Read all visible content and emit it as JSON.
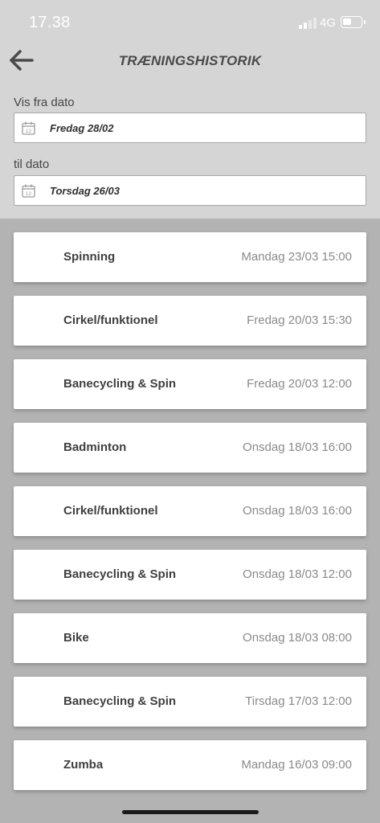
{
  "status_bar": {
    "time": "17.38",
    "network": "4G"
  },
  "header": {
    "title": "TRÆNINGSHISTORIK",
    "back_icon": "arrow-left-icon"
  },
  "filters": {
    "from_label": "Vis fra dato",
    "from_value": "Fredag 28/02",
    "to_label": "til dato",
    "to_value": "Torsdag 26/03",
    "calendar_icon": "calendar-icon",
    "calendar_day": "12"
  },
  "history": [
    {
      "name": "Spinning",
      "date": "Mandag 23/03 15:00"
    },
    {
      "name": "Cirkel/funktionel",
      "date": "Fredag 20/03 15:30"
    },
    {
      "name": "Banecycling & Spin",
      "date": "Fredag 20/03 12:00"
    },
    {
      "name": "Badminton",
      "date": "Onsdag 18/03 16:00"
    },
    {
      "name": "Cirkel/funktionel",
      "date": "Onsdag 18/03 16:00"
    },
    {
      "name": "Banecycling & Spin",
      "date": "Onsdag 18/03 12:00"
    },
    {
      "name": "Bike",
      "date": "Onsdag 18/03 08:00"
    },
    {
      "name": "Banecycling & Spin",
      "date": "Tirsdag 17/03 12:00"
    },
    {
      "name": "Zumba",
      "date": "Mandag 16/03 09:00"
    }
  ],
  "colors": {
    "top_background": "#d5d5d5",
    "list_background": "#b3b3b3",
    "card_background": "#ffffff"
  }
}
